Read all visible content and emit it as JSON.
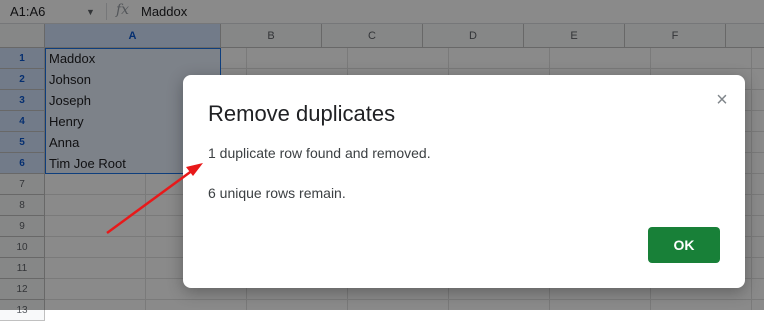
{
  "formula_bar": {
    "name_box": "A1:A6",
    "fx_icon": "fx",
    "value": "Maddox"
  },
  "sheet": {
    "columns": [
      "A",
      "B",
      "C",
      "D",
      "E",
      "F"
    ],
    "rows": [
      "1",
      "2",
      "3",
      "4",
      "5",
      "6",
      "7",
      "8",
      "9",
      "10",
      "11",
      "12",
      "13"
    ],
    "cells_col_a": [
      "Maddox",
      "Johson",
      "Joseph",
      "Henry",
      "Anna",
      "Tim Joe Root"
    ]
  },
  "dialog": {
    "title": "Remove duplicates",
    "close_icon": "×",
    "message_found": "1 duplicate row found and removed.",
    "message_remaining": "6 unique rows remain.",
    "ok_label": "OK",
    "ok_color": "#188038"
  },
  "annotation": {
    "arrow_color": "#e8191a",
    "arrow_icon": "red-pointer-arrow"
  }
}
